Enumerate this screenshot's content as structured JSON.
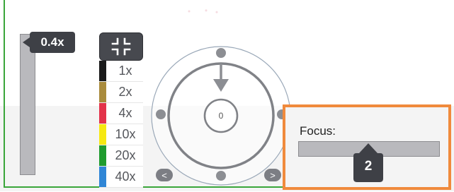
{
  "zoom": {
    "badge_label": "0.4x",
    "levels": [
      {
        "label": "1x",
        "color": "#1a1a1a"
      },
      {
        "label": "2x",
        "color": "#a98b3c"
      },
      {
        "label": "4x",
        "color": "#e3334a"
      },
      {
        "label": "10x",
        "color": "#f6e812"
      },
      {
        "label": "20x",
        "color": "#1f9b2e"
      },
      {
        "label": "40x",
        "color": "#2f86d6"
      }
    ],
    "collapse_icon": "collapse-icon"
  },
  "pan": {
    "center_value": "0",
    "prev_label": "<",
    "next_label": ">",
    "pointer_icon": "arrow-down-icon"
  },
  "focus": {
    "label": "Focus:",
    "value": "2"
  },
  "colors": {
    "accent_border": "#f08a3c",
    "frame_green": "#3aa63a",
    "badge_dark": "#3e4046"
  }
}
